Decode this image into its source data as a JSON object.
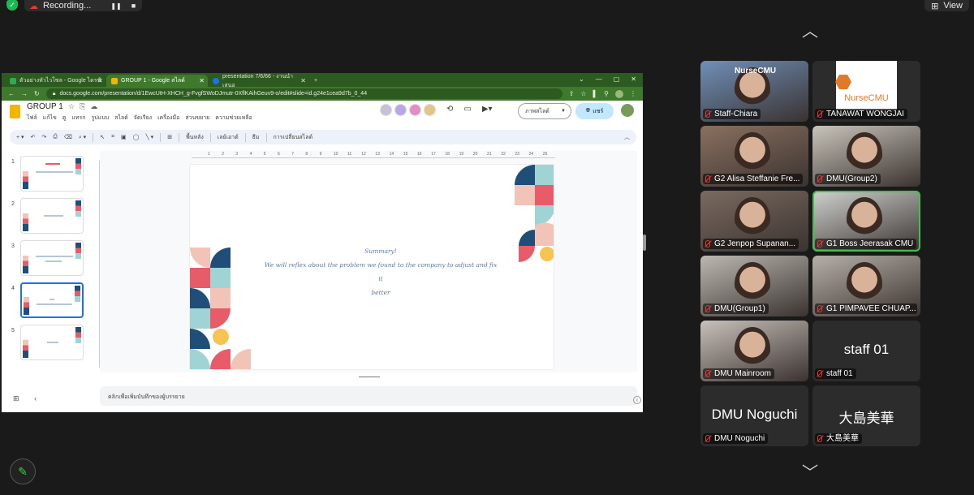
{
  "recording": {
    "label": "Recording...",
    "pause": "❚❚",
    "stop": "■"
  },
  "view": {
    "icon": "⊞",
    "label": "View"
  },
  "browser": {
    "tabs": [
      {
        "label": "ตัวอย่างหัวไวโซล - Google ไดรฟ์",
        "color": "#34a853"
      },
      {
        "label": "GROUP 1 - Google สไลด์",
        "color": "#f4b400"
      },
      {
        "label": "presentation 7/6/66 - งานนำเสนอ",
        "color": "#1a73e8"
      }
    ],
    "url": "docs.google.com/presentation/d/1EwcUtH-XHCH_g-FvgfSWoDJmutr-0XflKAihGeuv9-o/edit#slide=id.g24e1cea9d7b_0_44",
    "win_controls": [
      "⌄",
      "—",
      "▢",
      "✕"
    ]
  },
  "slides_app": {
    "title": "GROUP 1",
    "menu": [
      "ไฟล์",
      "แก้ไข",
      "ดู",
      "แทรก",
      "รูปแบบ",
      "สไลด์",
      "จัดเรียง",
      "เครื่องมือ",
      "ส่วนขยาย",
      "ความช่วยเหลือ"
    ],
    "slideshow_label": "ภาพสไลด์",
    "share_label": "แชร์",
    "toolbar": [
      "พื้นหลัง",
      "เลย์เอาต์",
      "ธีม",
      "การเปลี่ยนสไลด์"
    ],
    "thumb_numbers": [
      "1",
      "2",
      "3",
      "4",
      "5"
    ],
    "slide_text": {
      "line1": "Summary!",
      "line2": "We will reflex about the problem we found to the company to adjust and fix it",
      "line3": "better"
    },
    "notes_placeholder": "คลิกเพื่อเพิ่มบันทึกของผู้บรรยาย",
    "ruler_ticks": [
      "1",
      "2",
      "3",
      "4",
      "5",
      "6",
      "7",
      "8",
      "9",
      "10",
      "11",
      "12",
      "13",
      "14",
      "15",
      "16",
      "17",
      "18",
      "19",
      "20",
      "21",
      "22",
      "23",
      "24",
      "25"
    ]
  },
  "participants": [
    {
      "name": "Staff-Chiara",
      "type": "video",
      "bg": "#6f8fb8"
    },
    {
      "name": "TANAWAT WONGJAI",
      "type": "logo",
      "logo_text": "NurseCMU",
      "bg": "#ffffff"
    },
    {
      "name": "G2 Alisa Steffanie Fre...",
      "type": "video",
      "bg": "#8a7060"
    },
    {
      "name": "DMU(Group2)",
      "type": "video",
      "bg": "#c9c4bb"
    },
    {
      "name": "G2 Jenpop Supanan...",
      "type": "video",
      "bg": "#7a6a60"
    },
    {
      "name": "G1 Boss Jeerasak CMU",
      "type": "video",
      "bg": "#cfd2cf",
      "active": true
    },
    {
      "name": "DMU(Group1)",
      "type": "video",
      "bg": "#bdb8b2"
    },
    {
      "name": "G1 PIMPAVEE CHUAP...",
      "type": "video",
      "bg": "#b7b0a8"
    },
    {
      "name": "DMU Mainroom",
      "type": "video",
      "bg": "#c8c0ba"
    },
    {
      "name": "staff 01",
      "type": "name",
      "big": "staff 01"
    },
    {
      "name": "DMU Noguchi",
      "type": "name",
      "big": "DMU Noguchi"
    },
    {
      "name": "大島美華",
      "type": "name",
      "big": "大島美華"
    }
  ],
  "header_logo": "NurseCMU",
  "colors": {
    "browser_green": "#3f7a2c",
    "active_speaker": "#43c04a",
    "mic_muted": "#e53935",
    "slide_text": "#5d7aa6"
  }
}
